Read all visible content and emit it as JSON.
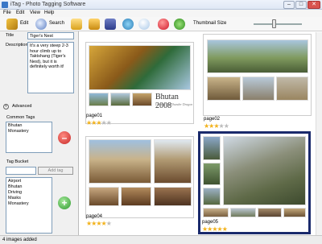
{
  "window": {
    "title": "iTag - Photo Tagging Software"
  },
  "menu": {
    "items": [
      "File",
      "Edit",
      "View",
      "Help"
    ]
  },
  "toolbar": {
    "edit_label": "Edit",
    "search_label": "Search",
    "thumbnail_size_label": "Thumbnail Size",
    "thumbnail_size_fraction": 0.42
  },
  "details": {
    "title_label": "Title",
    "title_value": "Tiger's Nest",
    "description_label": "Description",
    "description_value": "It's a very steep 2-3 hour climb up to Taktshang (Tiger's Nest), but it is definitely worth it!"
  },
  "advanced_label": "Advanced",
  "common_tags": {
    "label": "Common Tags",
    "items": [
      "Bhutan",
      "Monastery"
    ]
  },
  "tag_bucket": {
    "label": "Tag Bucket",
    "add_tag_label": "Add tag",
    "items": [
      "Airport",
      "Bhutan",
      "Driving",
      "Masks",
      "Monastery"
    ]
  },
  "gallery": {
    "pages": [
      {
        "name": "page01",
        "rating": 3,
        "banner": "Bhutan 2008",
        "banner_sub": "Land of the Thunder Dragon"
      },
      {
        "name": "page02",
        "rating": 3
      },
      {
        "name": "page04",
        "rating": 4
      },
      {
        "name": "page05",
        "rating": 5
      }
    ]
  },
  "status": {
    "text": "4 images added"
  },
  "colors": {
    "selection": "#1a2a6c",
    "star": "#f2b21b"
  }
}
